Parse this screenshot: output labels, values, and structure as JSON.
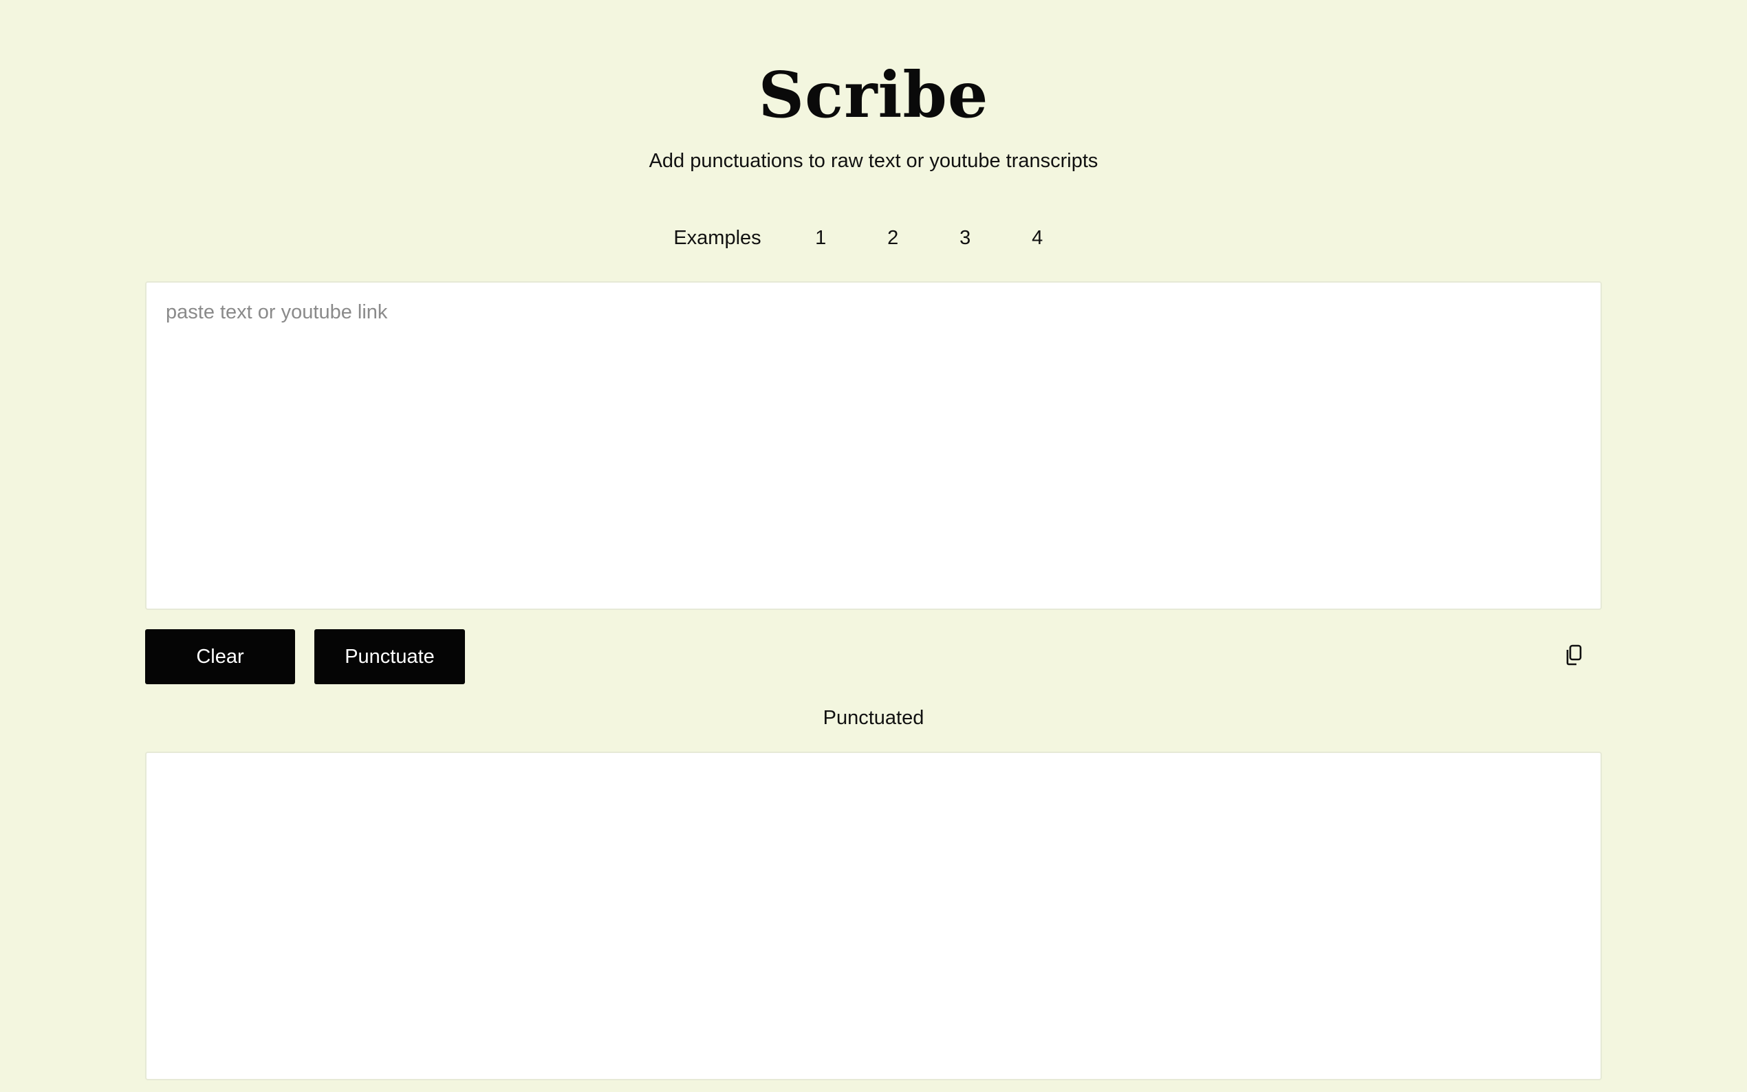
{
  "header": {
    "title": "Scribe",
    "subtitle": "Add punctuations to raw text or youtube transcripts"
  },
  "examples": {
    "label": "Examples",
    "items": [
      "1",
      "2",
      "3",
      "4"
    ]
  },
  "input": {
    "placeholder": "paste text or youtube link",
    "value": ""
  },
  "actions": {
    "clear_label": "Clear",
    "punctuate_label": "Punctuate",
    "copy_icon": "copy-icon"
  },
  "output": {
    "label": "Punctuated",
    "value": ""
  },
  "colors": {
    "background": "#f3f6df",
    "button": "#050505",
    "button_text": "#ffffff",
    "panel": "#ffffff"
  }
}
